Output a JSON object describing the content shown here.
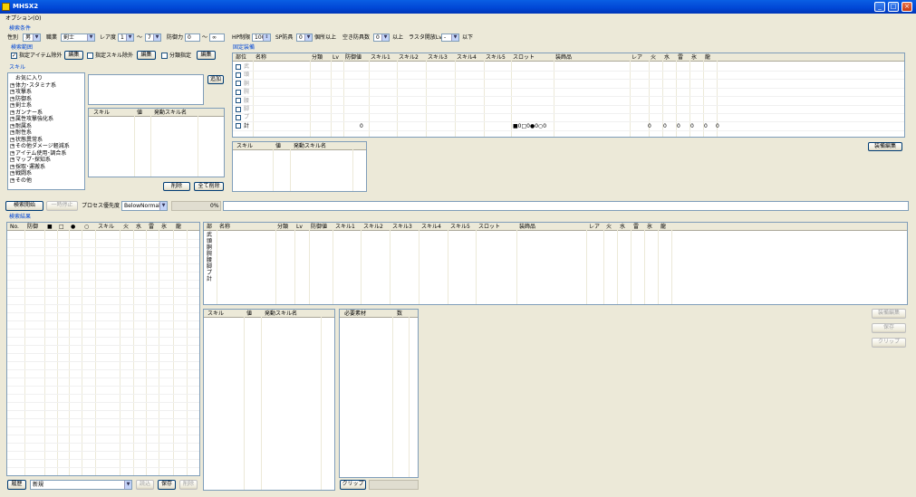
{
  "window": {
    "title": "MHSX2"
  },
  "menu": {
    "options": "オプション(O)"
  },
  "search_conditions": {
    "group_label": "検索条件",
    "gender_label": "性別",
    "gender_value": "男",
    "job_label": "職業",
    "job_value": "剣士",
    "rarity_label": "レア度",
    "rarity_min": "1",
    "rarity_tilde": "〜",
    "rarity_max": "7",
    "defense_label": "防御力",
    "defense_min": "0",
    "defense_tilde": "〜",
    "defense_max": "∞",
    "hp_label": "HP制限",
    "hp_value": "100",
    "sp_label": "SP防具",
    "sp_value": "0",
    "sp_suffix": "個所以上",
    "slot_label": "空き防具数",
    "slot_value": "0",
    "slot_suffix": "以上",
    "lastlv_label": "ラスタ開放Lv",
    "lastlv_value": "-",
    "lastlv_suffix": "以下"
  },
  "search_range": {
    "group_label": "検索範囲",
    "exclude_item": "指定アイテム除外",
    "edit1": "編集",
    "exclude_skill": "指定スキル除外",
    "edit2": "編集",
    "class_spec": "分類指定",
    "edit3": "編集"
  },
  "skills": {
    "group_label": "スキル",
    "tree": [
      "お気に入り",
      "体力･スタミナ系",
      "攻撃系",
      "防御系",
      "剣士系",
      "ガンナー系",
      "属性攻撃強化系",
      "耐属系",
      "耐性系",
      "状態異常系",
      "その他ダメージ軽減系",
      "アイテム使用･調合系",
      "マップ･探知系",
      "採取･運搬系",
      "戦闘系",
      "その他"
    ],
    "add_button": "追加",
    "table_headers": [
      "スキル",
      "値",
      "発動スキル名"
    ],
    "delete_button": "削除",
    "delete_all_button": "全て削除"
  },
  "fixed_equipment": {
    "group_label": "固定装備",
    "headers": [
      "部位",
      "名称",
      "分類",
      "Lv",
      "防御値",
      "スキル1",
      "スキル2",
      "スキル3",
      "スキル4",
      "スキル5",
      "スロット",
      "装飾品",
      "レア",
      "火",
      "水",
      "雷",
      "氷",
      "龍"
    ],
    "parts": [
      "武",
      "頭",
      "胴",
      "腕",
      "腰",
      "脚",
      "プ",
      "計"
    ],
    "total_defense": "0",
    "total_slot": "■0□0●0○0",
    "total_rare": "0",
    "total_fire": "0",
    "total_water": "0",
    "total_thunder": "0",
    "total_ice": "0",
    "total_dragon": "0",
    "skill_headers": [
      "スキル",
      "値",
      "発動スキル名"
    ],
    "edit_button": "装備編集"
  },
  "controls": {
    "start_button": "検索開始",
    "pause_button": "一時停止",
    "priority_label": "プロセス優先度",
    "priority_value": "BelowNormal",
    "progress_text": "0%",
    "progress": 0
  },
  "results": {
    "group_label": "検索結果",
    "headers": [
      "No.",
      "防御",
      "■",
      "□",
      "●",
      "○",
      "スキル",
      "火",
      "水",
      "雷",
      "氷",
      "龍"
    ],
    "history_label": "履歴",
    "history_value": "新規",
    "read_button": "読込",
    "save_button": "保存",
    "delete_button": "削除"
  },
  "detail": {
    "headers": [
      "部",
      "名称",
      "分類",
      "Lv",
      "防御値",
      "スキル1",
      "スキル2",
      "スキル3",
      "スキル4",
      "スキル5",
      "スロット",
      "装飾品",
      "レア",
      "火",
      "水",
      "雷",
      "氷",
      "龍"
    ],
    "parts": [
      "武",
      "頭",
      "胴",
      "腕",
      "腰",
      "脚",
      "プ",
      "計"
    ],
    "skill_headers": [
      "スキル",
      "値",
      "発動スキル名"
    ],
    "material_headers": [
      "必要素材",
      "数"
    ],
    "clip_button": "クリップ",
    "equip_edit_button": "装備編集",
    "save_button": "保存",
    "clip_button2": "クリップ"
  }
}
